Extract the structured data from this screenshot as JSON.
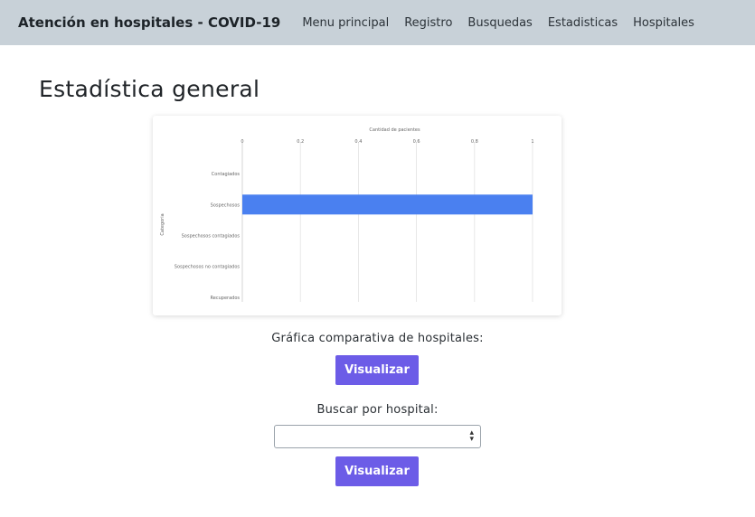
{
  "nav": {
    "brand": "Atención en hospitales - COVID-19",
    "links": [
      "Menu principal",
      "Registro",
      "Busquedas",
      "Estadisticas",
      "Hospitales"
    ]
  },
  "page": {
    "title": "Estadística general"
  },
  "chart_data": {
    "type": "bar",
    "orientation": "horizontal",
    "title": "Cantidad de pacientes",
    "ylabel": "Categoria",
    "categories": [
      "Contagiados",
      "Sospechosos",
      "Sospechosos contagiados",
      "Sospechosos no contagiados",
      "Recuperados"
    ],
    "values": [
      0,
      1,
      0,
      0,
      0
    ],
    "xlim": [
      0,
      1
    ],
    "xticks": [
      0,
      0.2,
      0.4,
      0.6,
      0.8,
      1
    ],
    "xtick_labels": [
      "0",
      "0.2",
      "0.4",
      "0.6",
      "0.8",
      "1"
    ],
    "bar_color": "#4a80f0",
    "grid": true,
    "axis_position": "top"
  },
  "compare": {
    "label": "Gráfica comparativa de hospitales:",
    "button": "Visualizar"
  },
  "search": {
    "label": "Buscar por hospital:",
    "selected": "",
    "button": "Visualizar"
  },
  "colors": {
    "navbar": "#c8d1d8",
    "button": "#6c5ce7"
  }
}
